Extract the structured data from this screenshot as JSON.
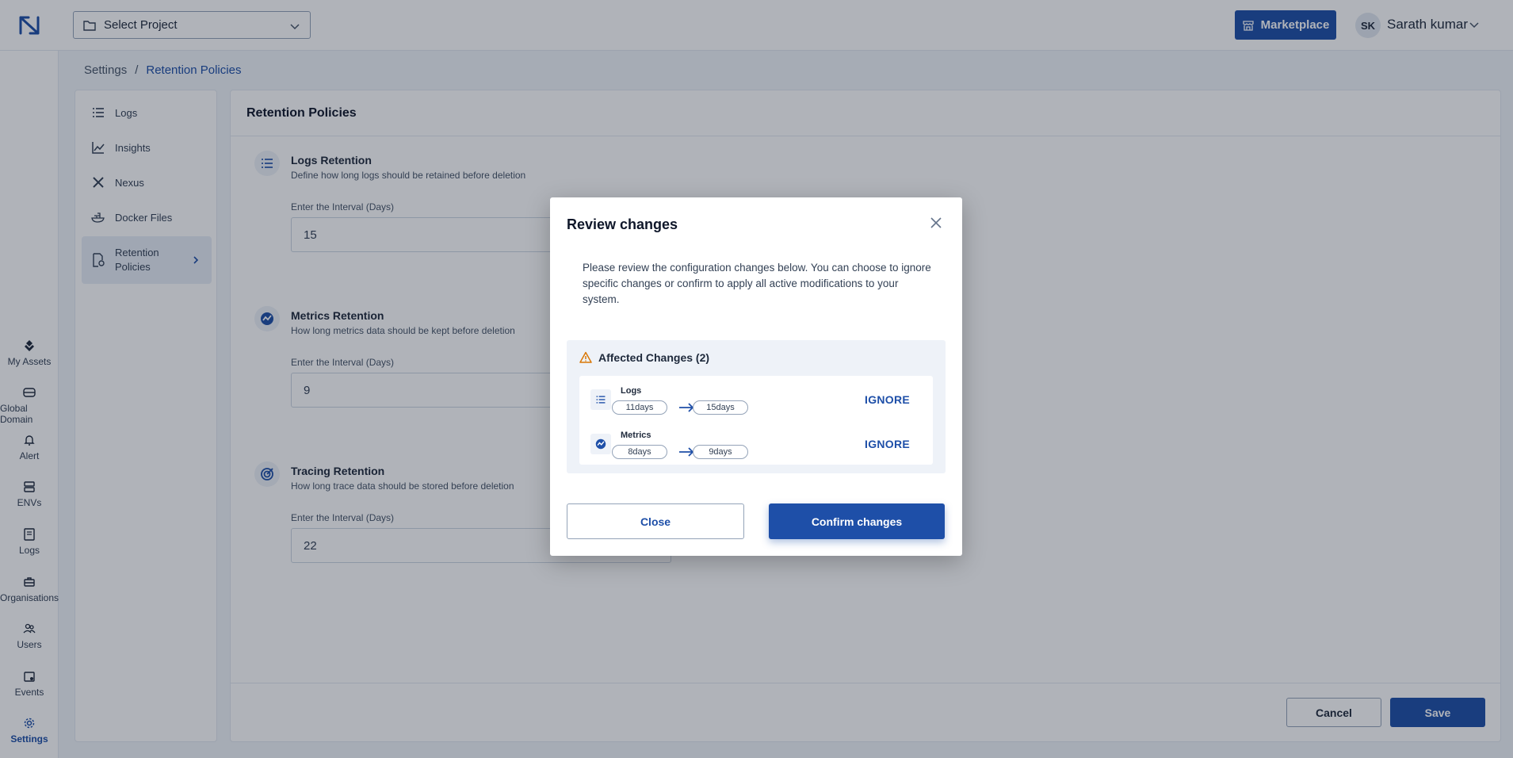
{
  "header": {
    "project_select": "Select Project",
    "marketplace": "Marketplace",
    "avatar_initials": "SK",
    "username": "Sarath kumar"
  },
  "rail": [
    {
      "label": "My Assets",
      "icon": "diamond-icon"
    },
    {
      "label": "Global Domain",
      "icon": "database-icon"
    },
    {
      "label": "Alert",
      "icon": "bell-icon"
    },
    {
      "label": "ENVs",
      "icon": "server-icon"
    },
    {
      "label": "Logs",
      "icon": "document-icon"
    },
    {
      "label": "Organisations",
      "icon": "briefcase-icon"
    },
    {
      "label": "Users",
      "icon": "users-icon"
    },
    {
      "label": "Events",
      "icon": "calendar-icon"
    },
    {
      "label": "Settings",
      "icon": "gear-icon",
      "active": true
    }
  ],
  "breadcrumb": {
    "parent": "Settings",
    "separator": "/",
    "current": "Retention Policies"
  },
  "settings_nav": [
    {
      "label": "Logs",
      "icon": "list-icon"
    },
    {
      "label": "Insights",
      "icon": "chart-line-icon"
    },
    {
      "label": "Nexus",
      "icon": "nexus-icon"
    },
    {
      "label": "Docker Files",
      "icon": "docker-icon"
    },
    {
      "label": "Retention\nPolicies",
      "icon": "retention-icon",
      "active": true
    }
  ],
  "main": {
    "title": "Retention Policies",
    "sections": [
      {
        "title": "Logs Retention",
        "description": "Define how long logs should be retained before deletion",
        "field_label": "Enter the Interval (Days)",
        "value": "15"
      },
      {
        "title": "Metrics Retention",
        "description": "How long metrics data should be kept before deletion",
        "field_label": "Enter the Interval (Days)",
        "value": "9"
      },
      {
        "title": "Tracing Retention",
        "description": "How long trace data should be stored before deletion",
        "field_label": "Enter the Interval (Days)",
        "value": "22"
      }
    ],
    "cancel": "Cancel",
    "save": "Save"
  },
  "modal": {
    "title": "Review changes",
    "description": "Please review the configuration changes below. You can choose to ignore specific changes or confirm to apply all active modifications to your system.",
    "affected_title": "Affected Changes (2)",
    "changes": [
      {
        "name": "Logs",
        "from": "11days",
        "to": "15days",
        "action": "IGNORE"
      },
      {
        "name": "Metrics",
        "from": "8days",
        "to": "9days",
        "action": "IGNORE"
      }
    ],
    "close": "Close",
    "confirm": "Confirm changes"
  },
  "colors": {
    "primary": "#1e4fa8",
    "overlay": "rgba(15,23,42,0.33)",
    "warning": "#d97706"
  }
}
